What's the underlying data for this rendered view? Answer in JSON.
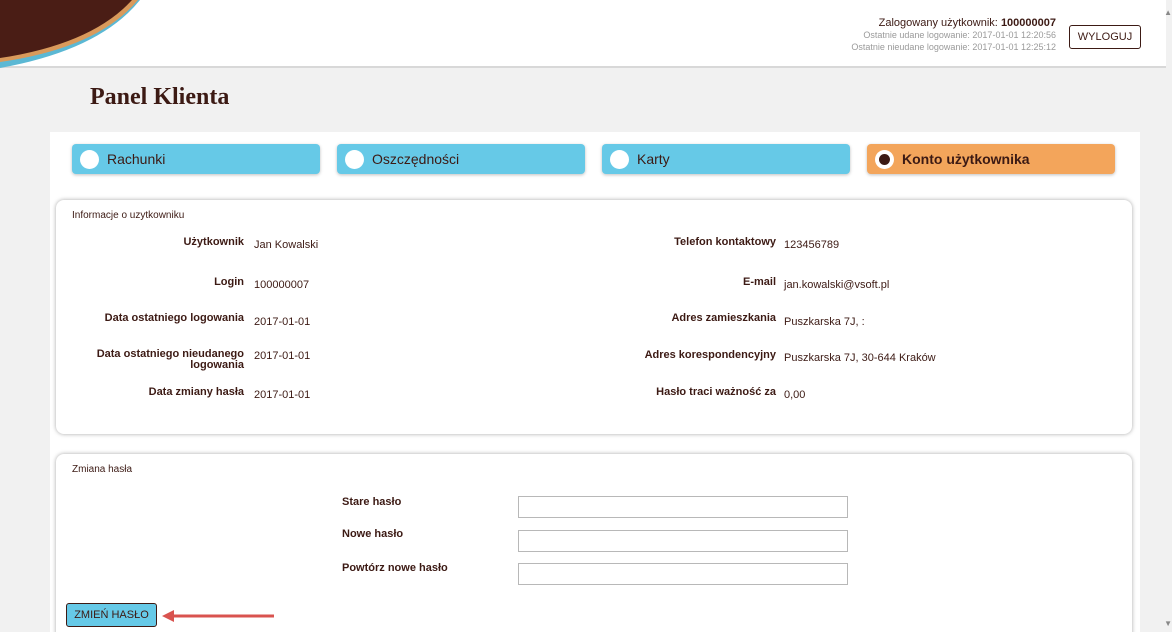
{
  "header": {
    "logged_user_label": "Zalogowany użytkownik:",
    "logged_user_id": "100000007",
    "last_success": "Ostatnie udane logowanie: 2017-01-01 12:20:56",
    "last_failed": "Ostatnie nieudane logowanie: 2017-01-01 12:25:12",
    "logout_label": "WYLOGUJ"
  },
  "page_title": "Panel Klienta",
  "tabs": [
    {
      "label": "Rachunki",
      "active": false
    },
    {
      "label": "Oszczędności",
      "active": false
    },
    {
      "label": "Karty",
      "active": false
    },
    {
      "label": "Konto użytkownika",
      "active": true
    }
  ],
  "user_info": {
    "title": "Informacje o uzytkowniku",
    "left": [
      {
        "label": "Użytkownik",
        "value": "Jan Kowalski"
      },
      {
        "label": "Login",
        "value": "100000007"
      },
      {
        "label": "Data ostatniego logowania",
        "value": "2017-01-01"
      },
      {
        "label": "Data ostatniego nieudanego logowania",
        "value": "2017-01-01"
      },
      {
        "label": "Data zmiany hasła",
        "value": "2017-01-01"
      }
    ],
    "right": [
      {
        "label": "Telefon kontaktowy",
        "value": "123456789"
      },
      {
        "label": "E-mail",
        "value": "jan.kowalski@vsoft.pl"
      },
      {
        "label": "Adres zamieszkania",
        "value": "Puszkarska 7J, :"
      },
      {
        "label": "Adres korespondencyjny",
        "value": "Puszkarska 7J, 30-644 Kraków"
      },
      {
        "label": "Hasło traci ważność za",
        "value": "0,00"
      }
    ]
  },
  "password_change": {
    "title": "Zmiana hasła",
    "fields": [
      {
        "label": "Stare hasło",
        "value": ""
      },
      {
        "label": "Nowe hasło",
        "value": ""
      },
      {
        "label": "Powtórz nowe hasło",
        "value": ""
      }
    ],
    "button_label": "ZMIEŃ HASŁO"
  },
  "colors": {
    "brand_dark": "#3c1a14",
    "tab_blue": "#66c9e7",
    "tab_active": "#f3a55b",
    "arrow_red": "#d9534f"
  }
}
